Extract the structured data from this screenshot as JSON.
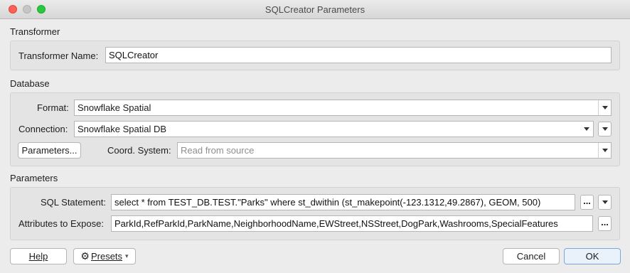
{
  "window": {
    "title": "SQLCreator Parameters"
  },
  "transformer_section": {
    "heading": "Transformer",
    "name_label": "Transformer Name:",
    "name_value": "SQLCreator"
  },
  "database_section": {
    "heading": "Database",
    "format_label": "Format:",
    "format_value": "Snowflake Spatial",
    "connection_label": "Connection:",
    "connection_value": "Snowflake Spatial DB",
    "parameters_button": "Parameters...",
    "coord_label": "Coord. System:",
    "coord_placeholder": "Read from source"
  },
  "parameters_section": {
    "heading": "Parameters",
    "sql_label": "SQL Statement:",
    "sql_value": "select * from TEST_DB.TEST.\"Parks\" where st_dwithin (st_makepoint(-123.1312,49.2867), GEOM, 500)",
    "attributes_label": "Attributes to Expose:",
    "attributes_value": "ParkId,RefParkId,ParkName,NeighborhoodName,EWStreet,NSStreet,DogPark,Washrooms,SpecialFeatures",
    "ellipsis": "..."
  },
  "footer": {
    "help_button": "Help",
    "presets_button": "Presets",
    "cancel_button": "Cancel",
    "ok_button": "OK"
  },
  "colors": {
    "close": "#fe5f57",
    "minimize": "#c6c6c6",
    "maximize": "#28c840",
    "default_button_border": "#7aa6de"
  }
}
